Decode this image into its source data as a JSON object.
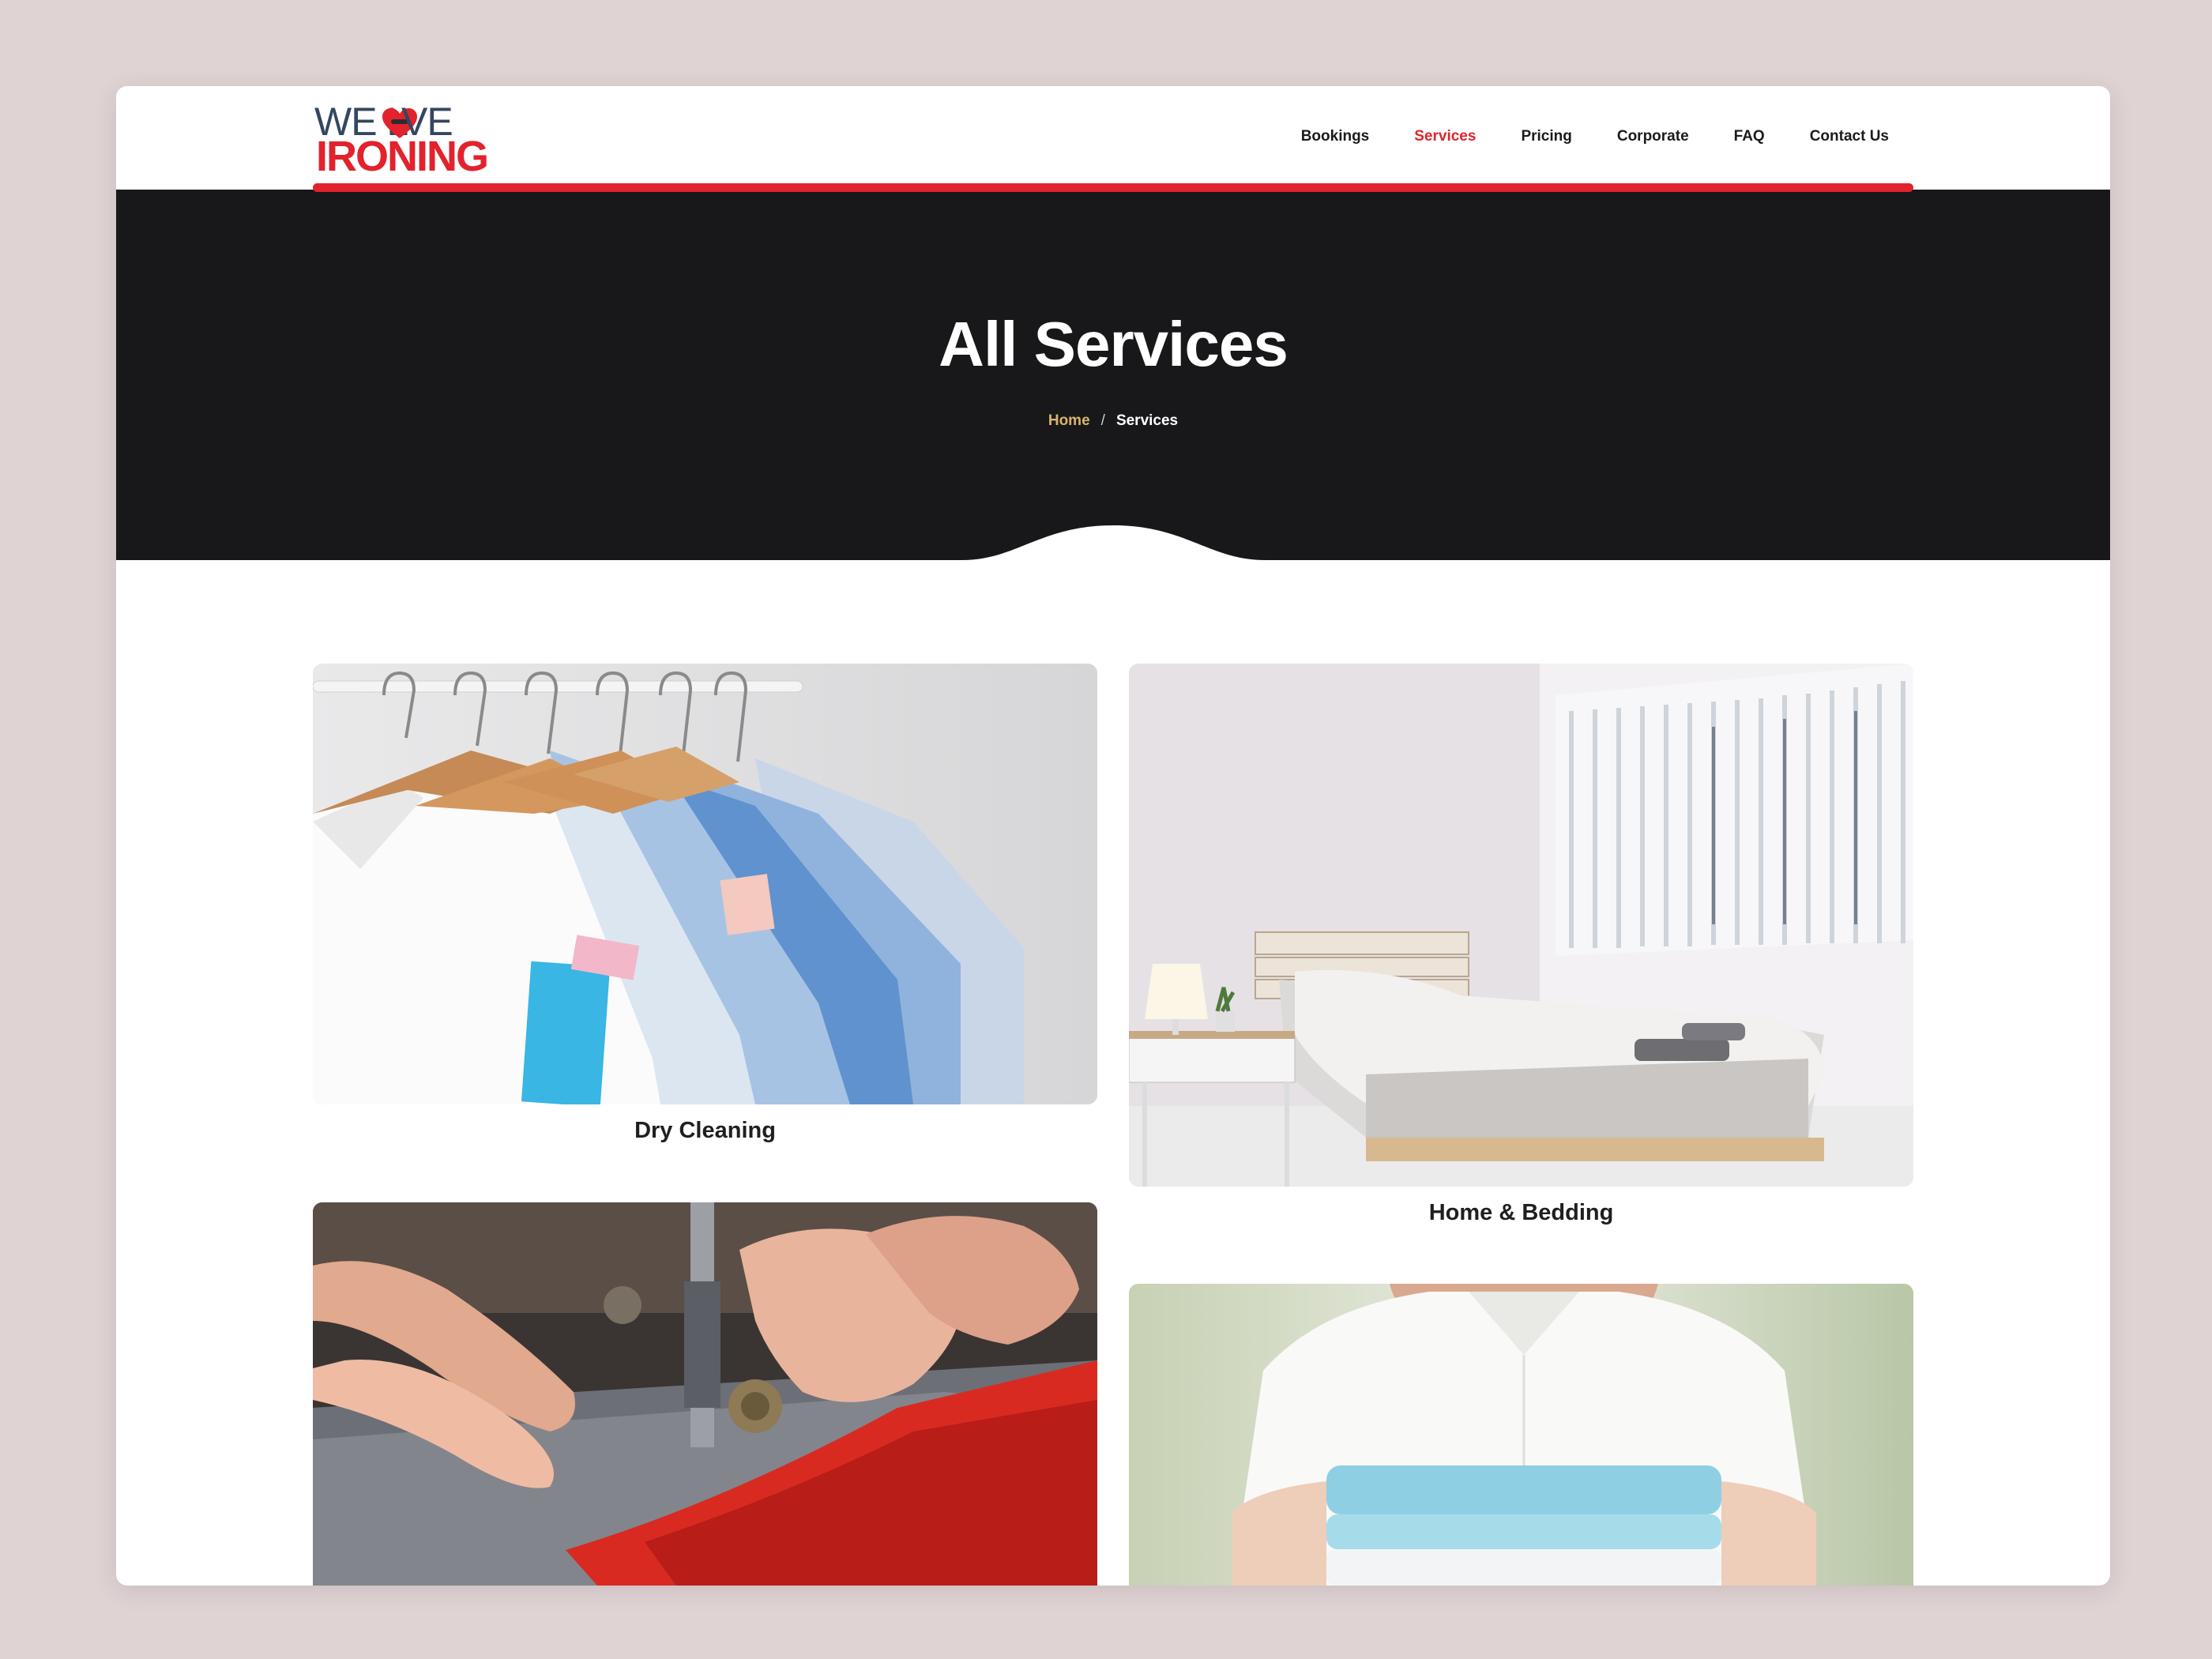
{
  "brand": {
    "logo_line1_a": "WE L",
    "logo_line1_b": "VE",
    "logo_line2": "IRONING",
    "colors": {
      "accent": "#e2222c",
      "navy": "#33475e",
      "dark": "#18181a",
      "breadcrumb_home": "#d9b46c"
    }
  },
  "nav": {
    "items": [
      {
        "label": "Bookings",
        "active": false
      },
      {
        "label": "Services",
        "active": true
      },
      {
        "label": "Pricing",
        "active": false
      },
      {
        "label": "Corporate",
        "active": false
      },
      {
        "label": "FAQ",
        "active": false
      },
      {
        "label": "Contact Us",
        "active": false
      }
    ]
  },
  "hero": {
    "title": "All Services",
    "breadcrumb": {
      "home": "Home",
      "separator": "/",
      "current": "Services"
    }
  },
  "services": [
    {
      "label": "Dry Cleaning",
      "image": "shirts-on-hangers"
    },
    {
      "label": "Home & Bedding",
      "image": "bedroom"
    },
    {
      "label": "",
      "image": "sewing-machine"
    },
    {
      "label": "",
      "image": "folded-linens"
    }
  ]
}
